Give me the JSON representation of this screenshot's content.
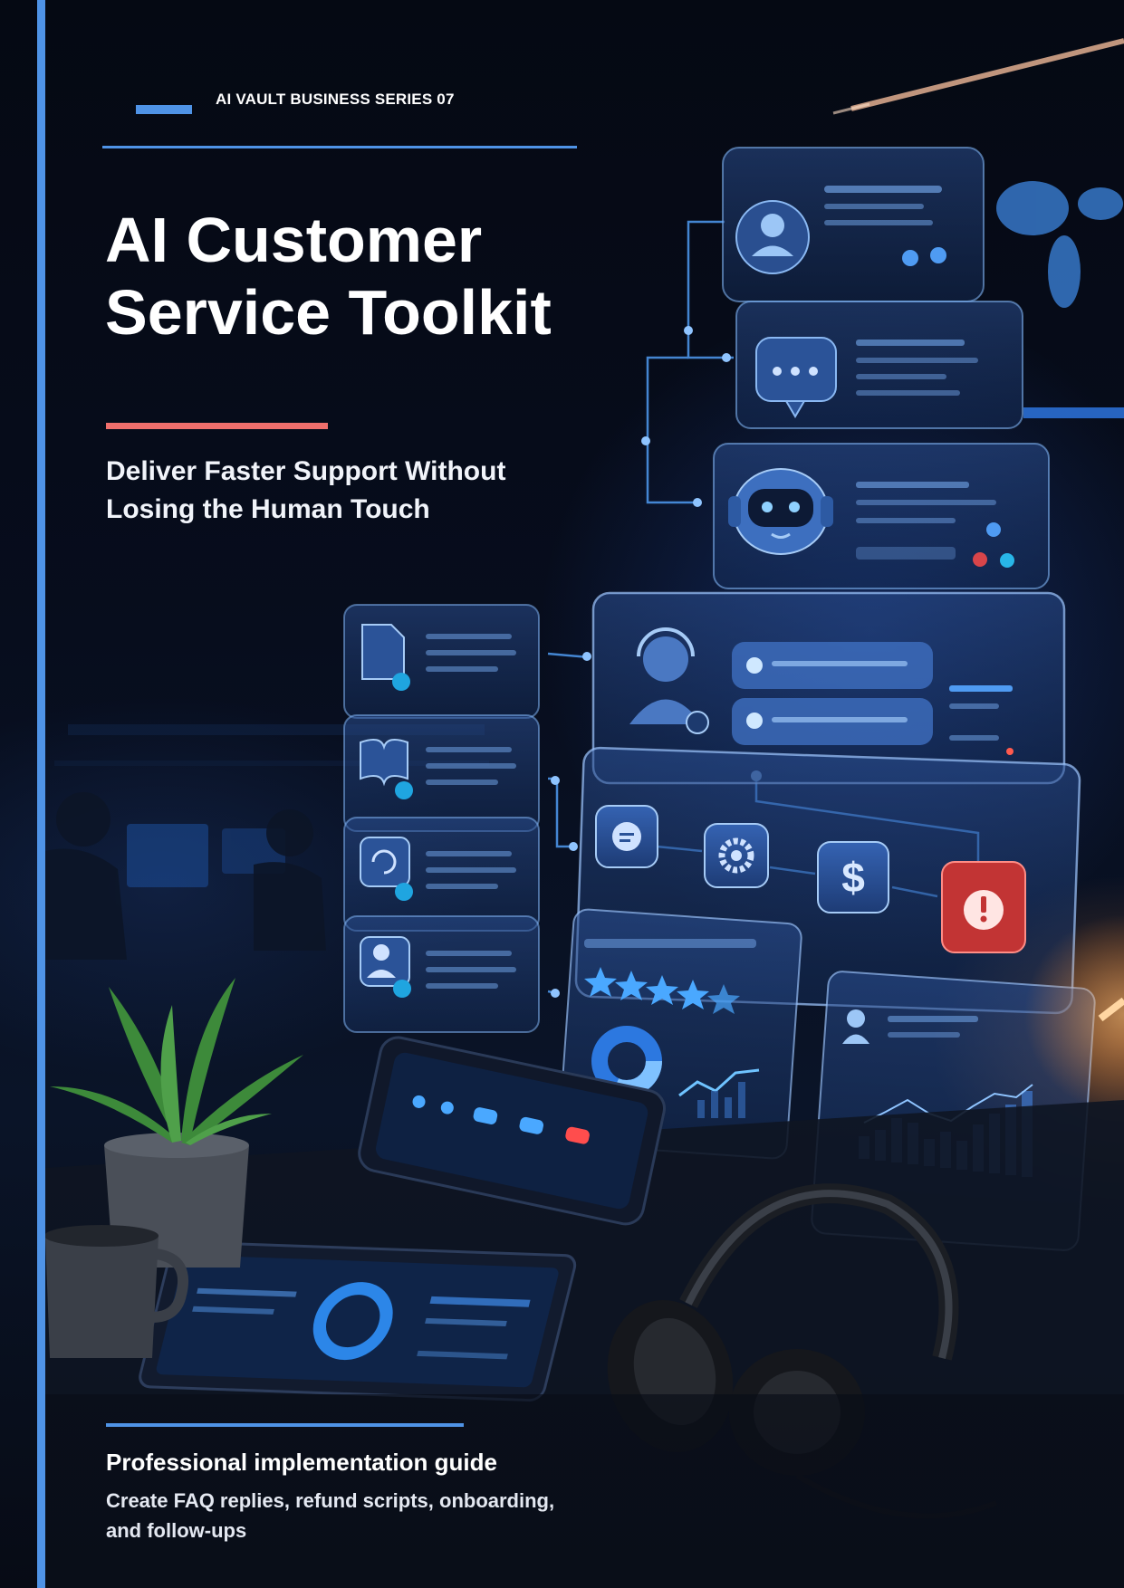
{
  "cover": {
    "series_label": "AI VAULT BUSINESS SERIES 07",
    "title_line1": "AI Customer",
    "title_line2": "Service Toolkit",
    "subtitle_line1": "Deliver Faster Support Without",
    "subtitle_line2": "Losing the Human Touch",
    "footer_heading": "Professional implementation guide",
    "footer_line1": "Create FAQ replies, refund scripts, onboarding,",
    "footer_line2": "and follow-ups"
  },
  "colors": {
    "accent_blue": "#4f93e6",
    "accent_red": "#ef6f6c",
    "background": "#060a16"
  },
  "illustration": {
    "icons": [
      "user-profile-icon",
      "chat-bubble-icon",
      "robot-icon",
      "document-check-icon",
      "book-check-icon",
      "refresh-check-icon",
      "person-check-icon",
      "headset-agent-icon",
      "message-icon",
      "gear-icon",
      "dollar-icon",
      "alert-icon",
      "star-rating-icon",
      "donut-chart-icon",
      "bar-chart-icon",
      "world-map-icon",
      "headphones-icon",
      "plant-icon",
      "mug-icon",
      "tablet-icon"
    ],
    "rating_stars": 5
  }
}
